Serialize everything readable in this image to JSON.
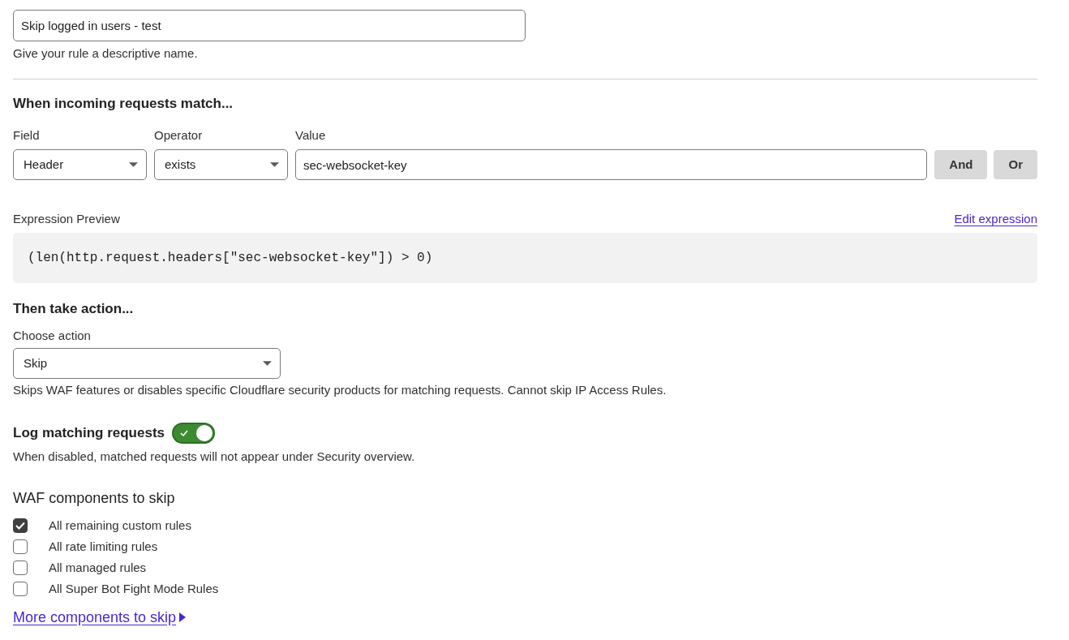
{
  "rule_name": {
    "value": "Skip logged in users - test",
    "help": "Give your rule a descriptive name."
  },
  "match": {
    "heading": "When incoming requests match...",
    "fields": [
      {
        "kind": "select",
        "label": "Field",
        "value": "Header"
      },
      {
        "kind": "select",
        "label": "Operator",
        "value": "exists"
      },
      {
        "kind": "text",
        "label": "Value",
        "value": "sec-websocket-key"
      }
    ],
    "buttons": [
      "And",
      "Or"
    ]
  },
  "expression_preview": {
    "label": "Expression Preview",
    "link": "Edit expression",
    "code": "(len(http.request.headers[\"sec-websocket-key\"]) > 0)"
  },
  "action": {
    "heading": "Then take action...",
    "label": "Choose action",
    "value": "Skip",
    "help": "Skips WAF features or disables specific Cloudflare security products for matching requests. Cannot skip IP Access Rules."
  },
  "logging": {
    "label": "Log matching requests",
    "on": true,
    "help": "When disabled, matched requests will not appear under Security overview."
  },
  "waf_skip": {
    "heading": "WAF components to skip",
    "options": [
      {
        "label": "All remaining custom rules",
        "checked": true
      },
      {
        "label": "All rate limiting rules",
        "checked": false
      },
      {
        "label": "All managed rules",
        "checked": false
      },
      {
        "label": "All Super Bot Fight Mode Rules",
        "checked": false
      }
    ],
    "link": "More components to skip"
  }
}
